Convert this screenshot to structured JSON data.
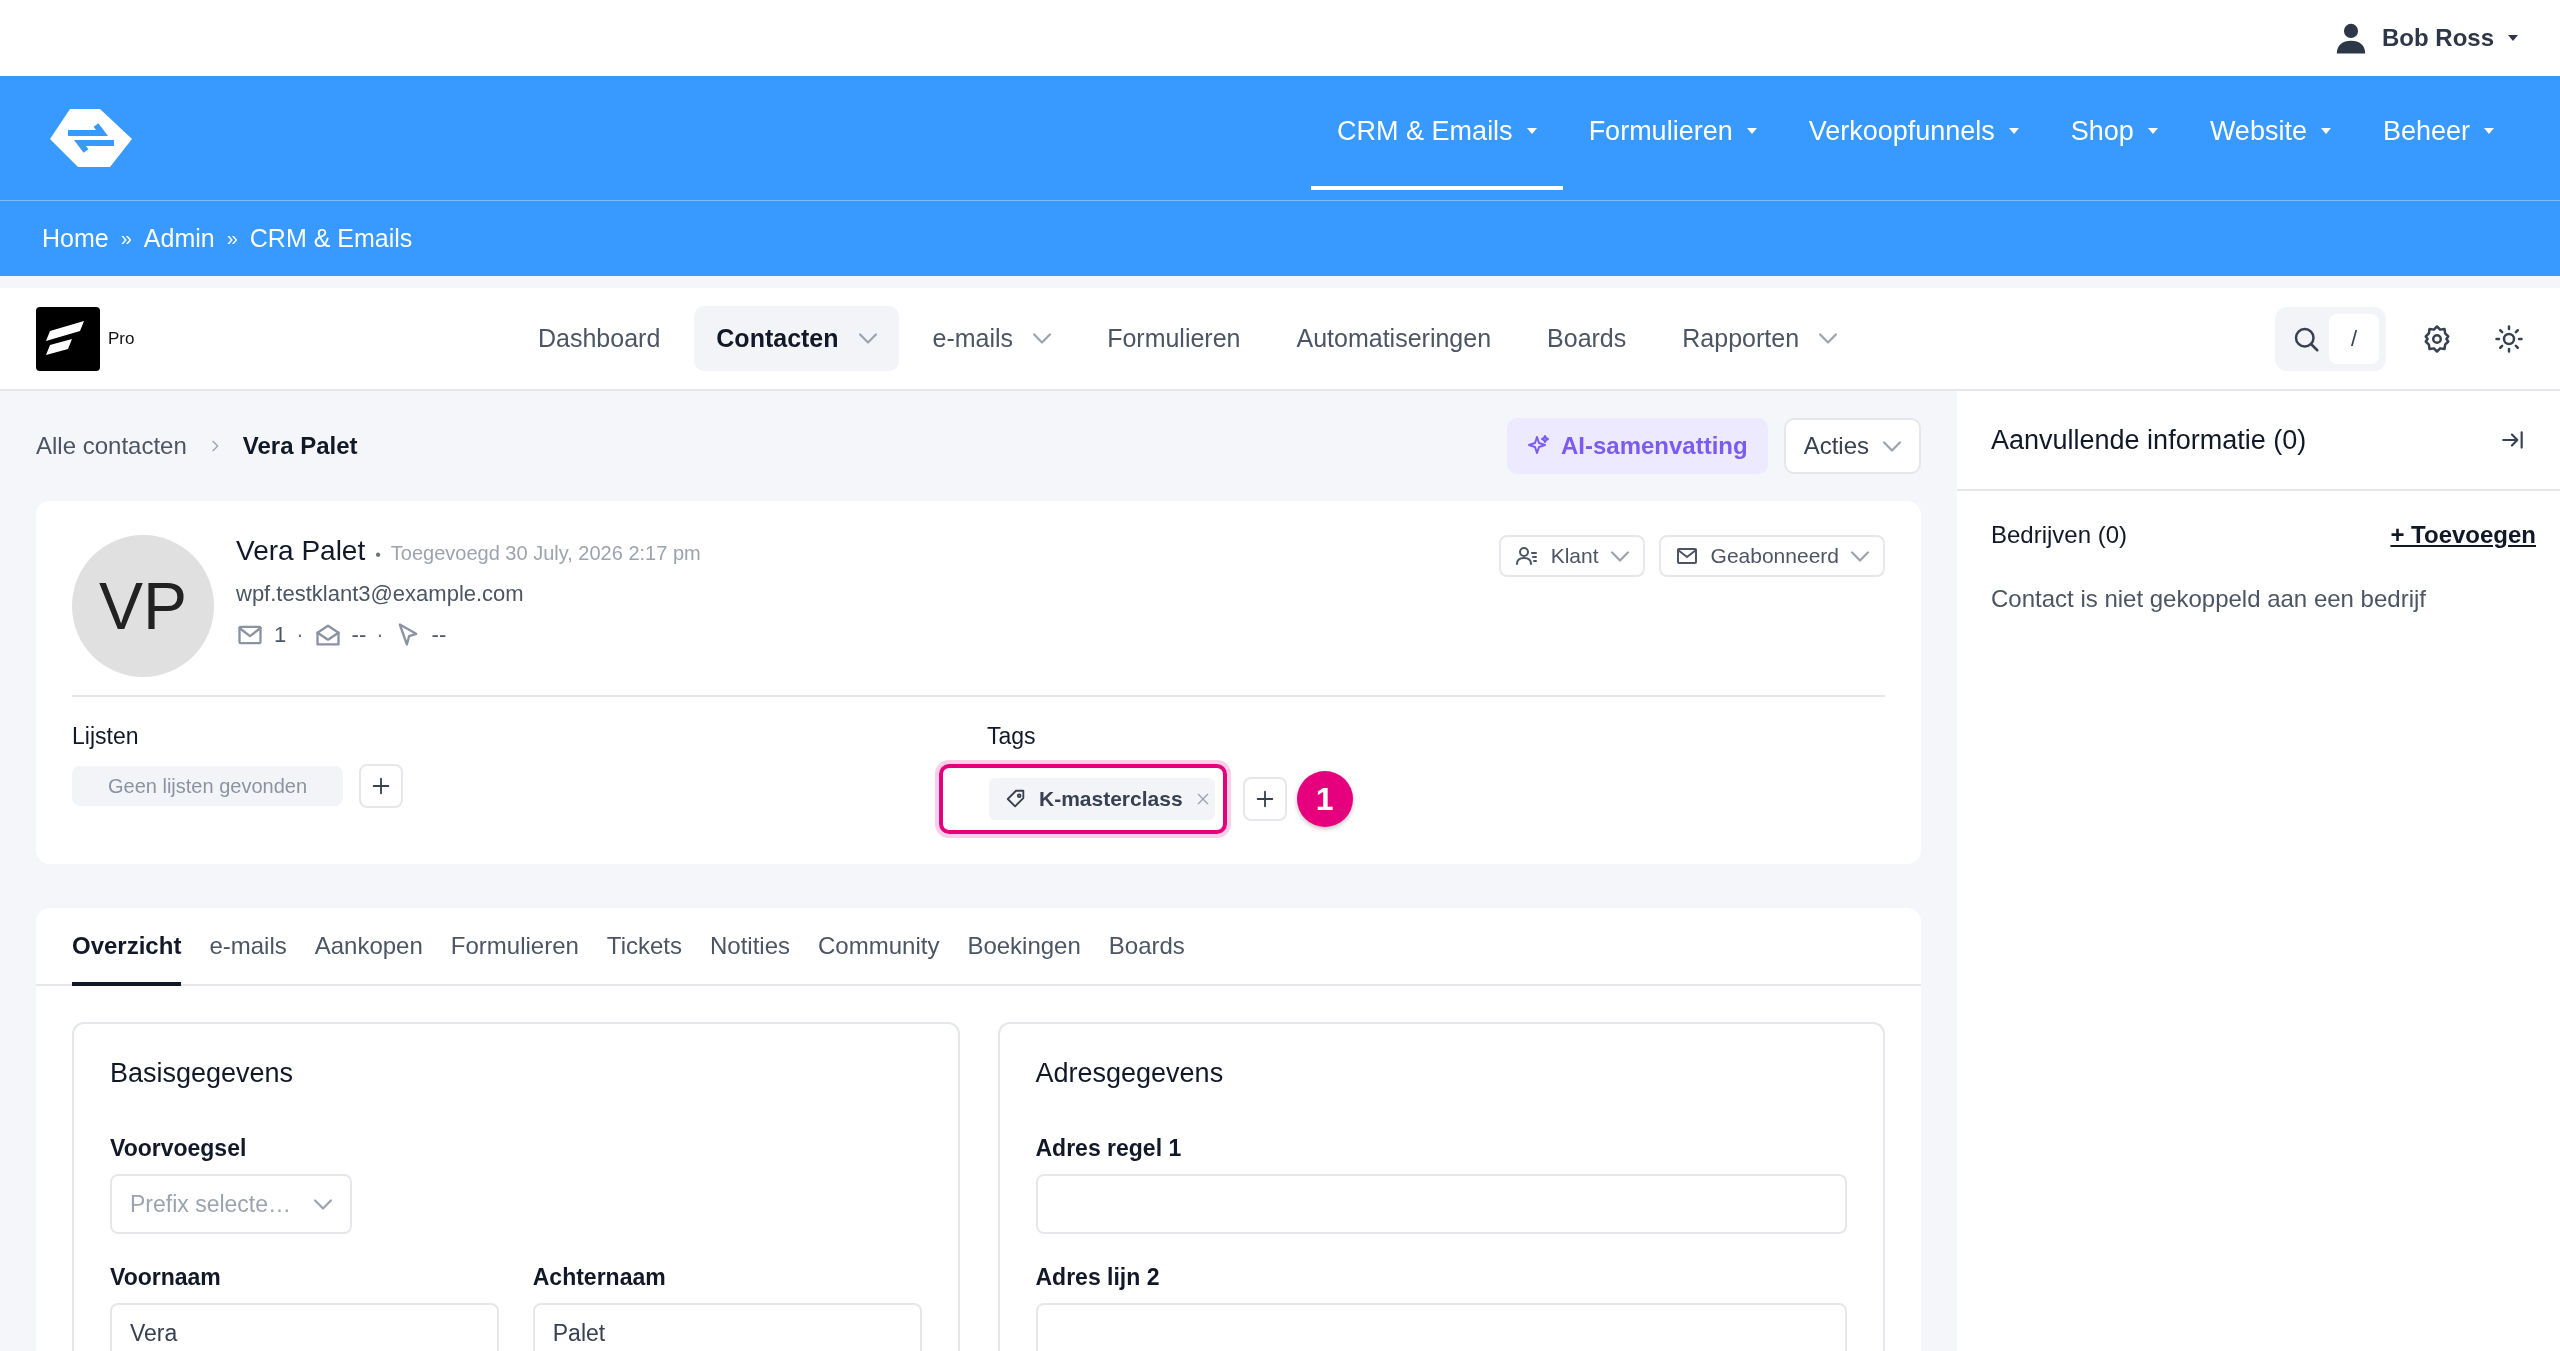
{
  "user_menu": {
    "name": "Bob Ross"
  },
  "main_nav": [
    {
      "label": "CRM & Emails",
      "selected": true
    },
    {
      "label": "Formulieren",
      "selected": false
    },
    {
      "label": "Verkoopfunnels",
      "selected": false
    },
    {
      "label": "Shop",
      "selected": false
    },
    {
      "label": "Website",
      "selected": false
    },
    {
      "label": "Beheer",
      "selected": false
    }
  ],
  "breadcrumb": {
    "separator": "»",
    "items": [
      "Home",
      "Admin",
      "CRM & Emails"
    ]
  },
  "app_bar": {
    "badge": "Pro",
    "search_shortcut": "/",
    "items": [
      {
        "label": "Dashboard",
        "selected": false,
        "dropdown": false
      },
      {
        "label": "Contacten",
        "selected": true,
        "dropdown": true
      },
      {
        "label": "e-mails",
        "selected": false,
        "dropdown": true
      },
      {
        "label": "Formulieren",
        "selected": false,
        "dropdown": false
      },
      {
        "label": "Automatiseringen",
        "selected": false,
        "dropdown": false
      },
      {
        "label": "Boards",
        "selected": false,
        "dropdown": false
      },
      {
        "label": "Rapporten",
        "selected": false,
        "dropdown": true
      }
    ]
  },
  "contact_breadcrumb": [
    "Alle contacten",
    "Vera Palet"
  ],
  "header_actions": {
    "ai_button": "AI-samenvatting",
    "actions_button": "Acties"
  },
  "contact": {
    "initials": "VP",
    "name": "Vera Palet",
    "name_separator": "•",
    "added": "Toegevoegd 30 July, 2026 2:17 pm",
    "email": "wpf.testklant3@example.com",
    "stat_separator": "·",
    "stats": [
      {
        "kind": "sent",
        "value": "1"
      },
      {
        "kind": "opened",
        "value": "--"
      },
      {
        "kind": "clicked",
        "value": "--"
      }
    ],
    "type_dropdown": "Klant",
    "status_dropdown": "Geabonneerd"
  },
  "lists": {
    "title": "Lijsten",
    "empty": "Geen lijsten gevonden"
  },
  "tags": {
    "title": "Tags",
    "highlighted": true,
    "callout": "1",
    "items": [
      {
        "label": "K-masterclass"
      }
    ]
  },
  "tabs": [
    {
      "label": "Overzicht",
      "selected": true
    },
    {
      "label": "e-mails",
      "selected": false
    },
    {
      "label": "Aankopen",
      "selected": false
    },
    {
      "label": "Formulieren",
      "selected": false
    },
    {
      "label": "Tickets",
      "selected": false
    },
    {
      "label": "Notities",
      "selected": false
    },
    {
      "label": "Community",
      "selected": false
    },
    {
      "label": "Boekingen",
      "selected": false
    },
    {
      "label": "Boards",
      "selected": false
    }
  ],
  "basic": {
    "title": "Basisgegevens",
    "fields": [
      {
        "kind": "select",
        "label": "Voorvoegsel",
        "placeholder": "Prefix selecte…"
      },
      {
        "kind": "text",
        "label": "Voornaam",
        "value": "Vera"
      },
      {
        "kind": "text",
        "label": "Achternaam",
        "value": "Palet"
      }
    ]
  },
  "address": {
    "title": "Adresgegevens",
    "fields": [
      {
        "kind": "text",
        "label": "Adres regel 1"
      },
      {
        "kind": "text",
        "label": "Adres lijn 2"
      }
    ]
  },
  "side_panel": {
    "title": "Aanvullende informatie (0)",
    "companies_title": "Bedrijven (0)",
    "add_link": "+ Toevoegen",
    "empty": "Contact is niet gekoppeld aan een bedrijf"
  }
}
